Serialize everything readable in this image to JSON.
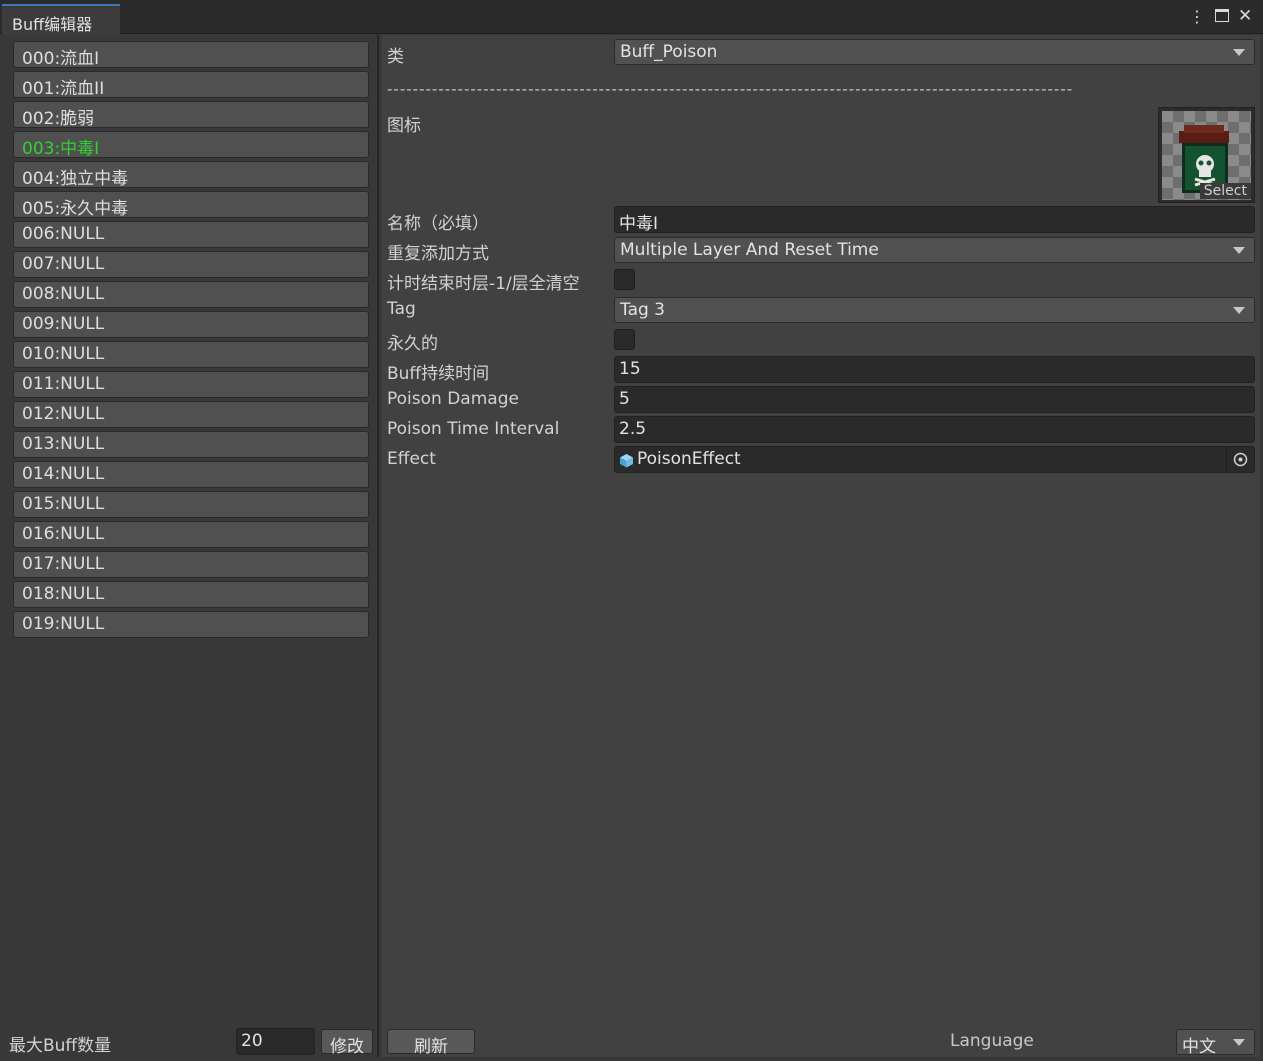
{
  "window": {
    "tab_title": "Buff编辑器",
    "menu_icon": "⋮",
    "maximize_icon": "▭",
    "close_icon": "✕"
  },
  "buff_list": [
    "000:流血I",
    "001:流血II",
    "002:脆弱",
    "003:中毒I",
    "004:独立中毒",
    "005:永久中毒",
    "006:NULL",
    "007:NULL",
    "008:NULL",
    "009:NULL",
    "010:NULL",
    "011:NULL",
    "012:NULL",
    "013:NULL",
    "014:NULL",
    "015:NULL",
    "016:NULL",
    "017:NULL",
    "018:NULL",
    "019:NULL"
  ],
  "selected_index": 3,
  "selected_color": "#2fd32f",
  "inspector": {
    "class_label": "类",
    "class_value": "Buff_Poison",
    "divider": "-----------------------------------------------------------------------------------------------------------",
    "icon_label": "图标",
    "icon_select": "Select",
    "name_label": "名称（必填）",
    "name_value": "中毒I",
    "repeat_label": "重复添加方式",
    "repeat_value": "Multiple Layer And Reset Time",
    "timer_clear_label": "计时结束时层-1/层全清空",
    "tag_label": "Tag",
    "tag_value": "Tag 3",
    "permanent_label": "永久的",
    "duration_label": "Buff持续时间",
    "duration_value": "15",
    "poison_damage_label": "Poison Damage",
    "poison_damage_value": "5",
    "poison_interval_label": "Poison Time Interval",
    "poison_interval_value": "2.5",
    "effect_label": "Effect",
    "effect_value": "PoisonEffect"
  },
  "footer": {
    "max_buff_label": "最大Buff数量",
    "max_buff_value": "20",
    "modify_button": "修改",
    "refresh_button": "刷新",
    "language_label": "Language",
    "language_value": "中文"
  }
}
